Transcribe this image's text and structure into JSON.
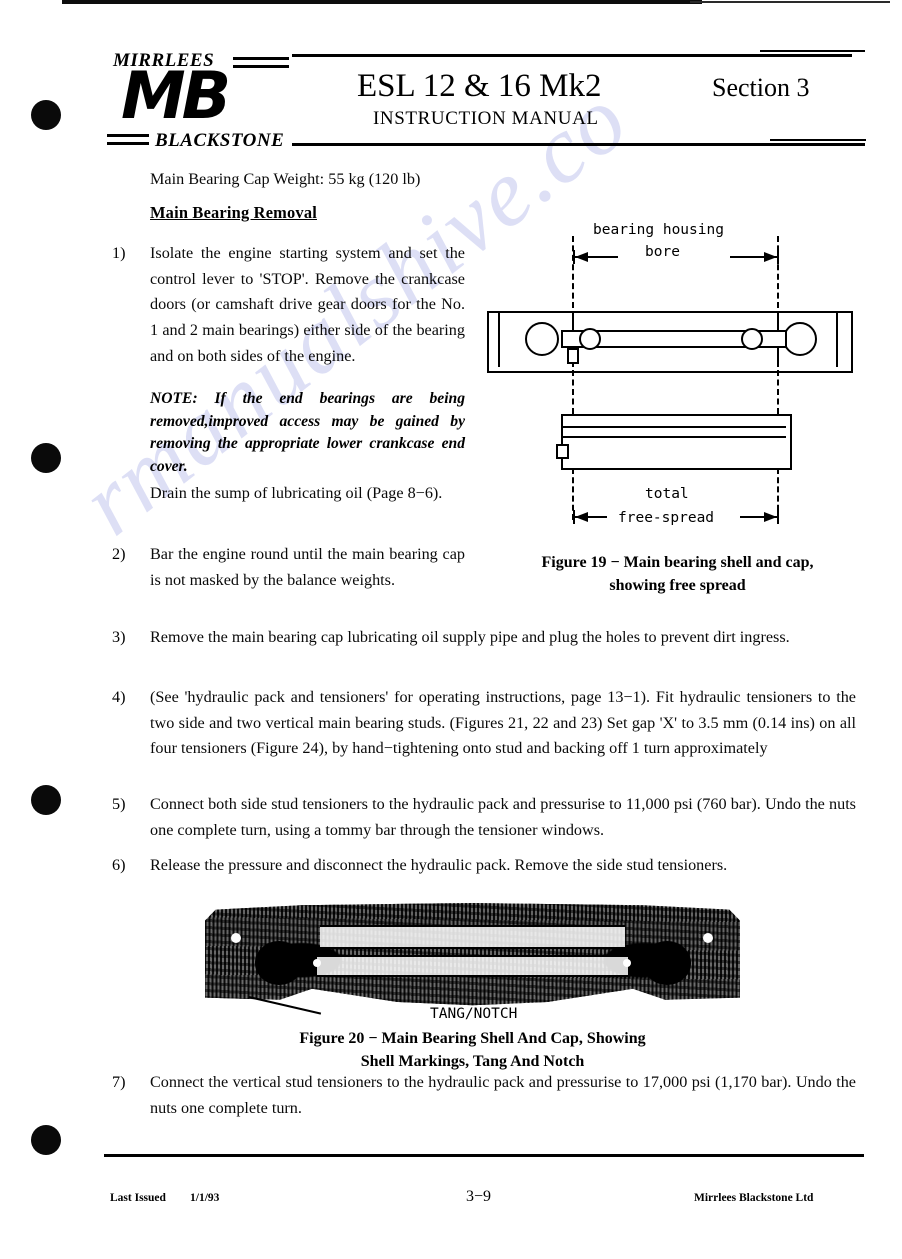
{
  "document": {
    "header": {
      "logo_top": "MIRRLEES",
      "logo_mark": "MB",
      "logo_bottom": "BLACKSTONE",
      "title": "ESL 12 & 16 Mk2",
      "subtitle": "INSTRUCTION  MANUAL",
      "section": "Section 3"
    },
    "watermark": "rmanualshive.co",
    "body": {
      "intro": "Main Bearing Cap Weight: 55 kg (120 lb)",
      "heading": "Main Bearing Removal",
      "steps": [
        {
          "number": "1)",
          "text": "Isolate the engine starting system and set the control lever to 'STOP'.  Remove the crankcase doors (or camshaft drive gear doors for the No. 1 and 2 main bearings) either side of the bearing and on both sides of the engine."
        },
        {
          "number": "2)",
          "text": "Bar the engine round until the main bearing cap is not masked by the balance weights."
        },
        {
          "number": "3)",
          "text": "Remove the main bearing cap lubricating oil supply pipe and plug the holes to prevent dirt ingress."
        },
        {
          "number": "4)",
          "text": "(See 'hydraulic pack and tensioners' for operating instructions, page 13−1). Fit hydraulic tensioners to the two side and two vertical main bearing studs.  (Figures 21, 22 and 23) Set gap 'X' to 3.5 mm (0.14 ins) on all four tensioners (Figure 24), by hand−tightening onto stud and backing off 1 turn approximately"
        },
        {
          "number": "5)",
          "text": "Connect both side stud tensioners to the hydraulic pack and pressurise to 11,000 psi (760 bar).  Undo the nuts one complete turn, using a tommy bar through the tensioner windows."
        },
        {
          "number": "6)",
          "text": "Release the pressure and disconnect the hydraulic pack.  Remove the side stud tensioners."
        },
        {
          "number": "7)",
          "text": "Connect the vertical stud tensioners to the hydraulic pack and pressurise to 17,000 psi (1,170 bar).  Undo the nuts one complete turn."
        }
      ],
      "note": "NOTE: If the end bearings are being removed,improved access may be gained by removing the appropriate lower crankcase end cover.",
      "drain": "Drain the sump of lubricating oil (Page 8−6)."
    },
    "figure19": {
      "label_top_line1": "bearing housing",
      "label_top_line2": "bore",
      "label_bottom_line1": "total",
      "label_bottom_line2": "free-spread",
      "caption_line1": "Figure 19 − Main bearing shell and cap,",
      "caption_line2": "showing free spread"
    },
    "figure20": {
      "callout": "TANG/NOTCH",
      "caption_line1": "Figure 20 − Main Bearing Shell And Cap, Showing",
      "caption_line2": "Shell Markings, Tang And Notch"
    },
    "footer": {
      "left_label": "Last Issued",
      "left_date": "1/1/93",
      "page_number": "3−9",
      "right": "Mirrlees Blackstone Ltd"
    }
  }
}
